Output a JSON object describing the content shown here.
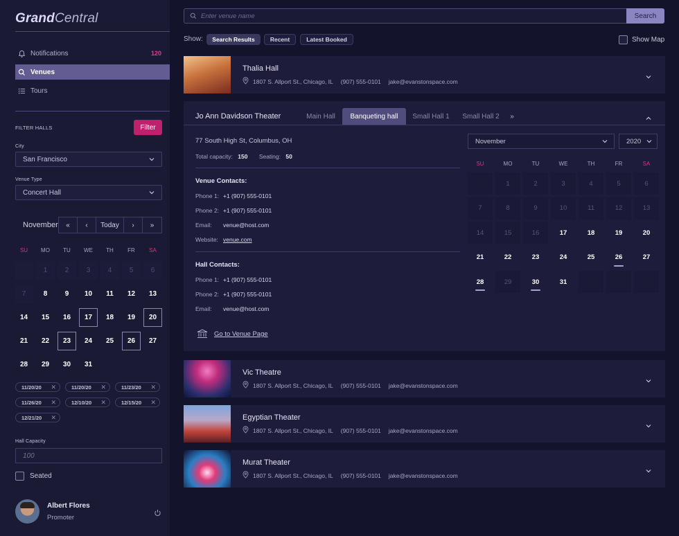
{
  "app": {
    "logo_bold": "Grand",
    "logo_rest": "Central"
  },
  "sidebar": {
    "nav": [
      {
        "label": "Notifications",
        "icon": "bell-icon",
        "badge": "120"
      },
      {
        "label": "Venues",
        "icon": "search-icon",
        "active": true
      },
      {
        "label": "Tours",
        "icon": "list-icon"
      }
    ],
    "filter_title": "FILTER HALLS",
    "filter_button": "Filter",
    "city_label": "City",
    "city_value": "San Francisco",
    "venue_type_label": "Venue Type",
    "venue_type_value": "Concert Hall",
    "calendar": {
      "month": "November",
      "today_label": "Today",
      "dow": [
        "SU",
        "MO",
        "TU",
        "WE",
        "TH",
        "FR",
        "SA"
      ],
      "weeks": [
        [
          "",
          "1",
          "2",
          "3",
          "4",
          "5",
          "6"
        ],
        [
          "7",
          "8",
          "9",
          "10",
          "11",
          "12",
          "13"
        ],
        [
          "14",
          "15",
          "16",
          "17",
          "18",
          "19",
          "20"
        ],
        [
          "21",
          "22",
          "23",
          "24",
          "25",
          "26",
          "27"
        ],
        [
          "28",
          "29",
          "30",
          "31",
          "",
          "",
          ""
        ]
      ],
      "selected": [
        "17",
        "20",
        "23",
        "26"
      ]
    },
    "chips": [
      "11/20/20",
      "11/20/20",
      "11/23/20",
      "11/26/20",
      "12/10/20",
      "12/15/20",
      "12/21/20"
    ],
    "capacity_label": "Hall Capacity",
    "capacity_placeholder": "100",
    "seated_label": "Seated",
    "user": {
      "name": "Albert Flores",
      "role": "Promoter"
    }
  },
  "search": {
    "placeholder": "Enter venue name",
    "button": "Search"
  },
  "show": {
    "label": "Show:",
    "options": [
      "Search Results",
      "Recent",
      "Latest Booked"
    ],
    "active": "Search Results",
    "map_label": "Show Map"
  },
  "venues": [
    {
      "name": "Thalia Hall",
      "address": "1807 S. Allport St., Chicago, IL",
      "phone": "(907) 555-0101",
      "email": "jake@evanstonspace.com",
      "thumb_colors": [
        "#e8a36a",
        "#8a2b24"
      ]
    },
    {
      "name": "Vic Theatre",
      "address": "1807 S. Allport St., Chicago, IL",
      "phone": "(907) 555-0101",
      "email": "jake@evanstonspace.com",
      "thumb_colors": [
        "#d62f8a",
        "#1d2a6a"
      ]
    },
    {
      "name": "Egyptian Theater",
      "address": "1807 S. Allport St., Chicago, IL",
      "phone": "(907) 555-0101",
      "email": "jake@evanstonspace.com",
      "thumb_colors": [
        "#7aa0d8",
        "#b3352b"
      ]
    },
    {
      "name": "Murat Theater",
      "address": "1807 S. Allport St., Chicago, IL",
      "phone": "(907) 555-0101",
      "email": "jake@evanstonspace.com",
      "thumb_colors": [
        "#e23a78",
        "#2a7fc4"
      ]
    }
  ],
  "expanded": {
    "name": "Jo Ann Davidson Theater",
    "tabs": [
      "Main Hall",
      "Banqueting hall",
      "Small Hall 1",
      "Small Hall 2"
    ],
    "active_tab": "Banqueting hall",
    "address": "77 South High St, Columbus, OH",
    "capacity_label": "Total capacity:",
    "capacity_value": "150",
    "seating_label": "Seating:",
    "seating_value": "50",
    "venue_contacts_title": "Venue Contacts:",
    "venue_contacts": [
      {
        "label": "Phone 1:",
        "value": "+1 (907) 555-0101"
      },
      {
        "label": "Phone 2:",
        "value": "+1 (907) 555-0101"
      },
      {
        "label": "Email:",
        "value": "venue@host.com"
      },
      {
        "label": "Website:",
        "value": "venue.com"
      }
    ],
    "hall_contacts_title": "Hall Contacts:",
    "hall_contacts": [
      {
        "label": "Phone 1:",
        "value": "+1 (907) 555-0101"
      },
      {
        "label": "Phone 2:",
        "value": "+1 (907) 555-0101"
      },
      {
        "label": "Email:",
        "value": "venue@host.com"
      }
    ],
    "go_link": "Go to Venue Page",
    "calendar": {
      "month": "November",
      "year": "2020",
      "dow": [
        "SU",
        "MO",
        "TU",
        "WE",
        "TH",
        "FR",
        "SA"
      ],
      "weeks": [
        [
          "",
          "1",
          "2",
          "3",
          "4",
          "5",
          "6"
        ],
        [
          "7",
          "8",
          "9",
          "10",
          "11",
          "12",
          "13"
        ],
        [
          "14",
          "15",
          "16",
          "17",
          "18",
          "19",
          "20"
        ],
        [
          "21",
          "22",
          "23",
          "24",
          "25",
          "26",
          "27"
        ],
        [
          "28",
          "29",
          "30",
          "31",
          "",
          "",
          ""
        ]
      ],
      "marked": [
        "26",
        "28",
        "30"
      ]
    }
  },
  "colors": {
    "accent": "#c0216f",
    "active_nav": "#635c92",
    "weekend": "#d8357f",
    "background": "#13132b"
  }
}
